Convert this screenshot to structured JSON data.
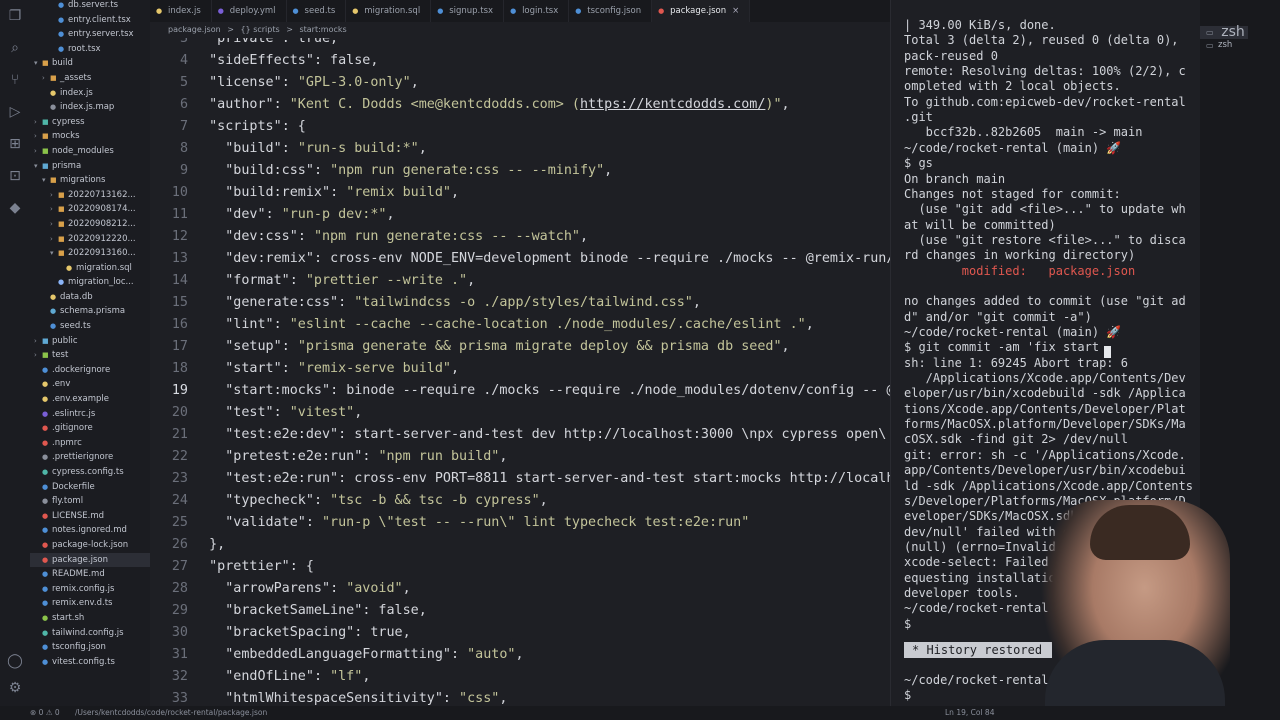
{
  "activity_icons": [
    "files-icon",
    "search-icon",
    "source-control-icon",
    "run-debug-icon",
    "extensions-icon",
    "remote-icon",
    "docker-icon",
    "account-icon",
    "settings-icon"
  ],
  "sidebar": {
    "items": [
      {
        "label": "db.server.ts",
        "indent": 3,
        "kind": "file",
        "color": "#4e8fd6"
      },
      {
        "label": "entry.client.tsx",
        "indent": 3,
        "kind": "file",
        "color": "#4e8fd6"
      },
      {
        "label": "entry.server.tsx",
        "indent": 3,
        "kind": "file",
        "color": "#4e8fd6"
      },
      {
        "label": "root.tsx",
        "indent": 3,
        "kind": "file",
        "color": "#4e8fd6"
      },
      {
        "label": "build",
        "indent": 1,
        "kind": "folder-open",
        "color": "#d8a04a"
      },
      {
        "label": "_assets",
        "indent": 2,
        "kind": "folder",
        "color": "#d8a04a"
      },
      {
        "label": "index.js",
        "indent": 2,
        "kind": "file",
        "color": "#e5c76b"
      },
      {
        "label": "index.js.map",
        "indent": 2,
        "kind": "file",
        "color": "#8a8f9b"
      },
      {
        "label": "cypress",
        "indent": 1,
        "kind": "folder",
        "color": "#4fb6a8"
      },
      {
        "label": "mocks",
        "indent": 1,
        "kind": "folder",
        "color": "#d8a04a"
      },
      {
        "label": "node_modules",
        "indent": 1,
        "kind": "folder",
        "color": "#8bc34a"
      },
      {
        "label": "prisma",
        "indent": 1,
        "kind": "folder-open",
        "color": "#5fa9d3"
      },
      {
        "label": "migrations",
        "indent": 2,
        "kind": "folder-open",
        "color": "#d8a04a"
      },
      {
        "label": "20220713162...",
        "indent": 3,
        "kind": "folder",
        "color": "#d8a04a"
      },
      {
        "label": "20220908174...",
        "indent": 3,
        "kind": "folder",
        "color": "#d8a04a"
      },
      {
        "label": "20220908212...",
        "indent": 3,
        "kind": "folder",
        "color": "#d8a04a"
      },
      {
        "label": "20220912220...",
        "indent": 3,
        "kind": "folder",
        "color": "#d8a04a"
      },
      {
        "label": "20220913160...",
        "indent": 3,
        "kind": "folder-open",
        "color": "#d8a04a"
      },
      {
        "label": "migration.sql",
        "indent": 4,
        "kind": "file",
        "color": "#e5c76b"
      },
      {
        "label": "migration_loc...",
        "indent": 3,
        "kind": "file",
        "color": "#8ab4f8"
      },
      {
        "label": "data.db",
        "indent": 2,
        "kind": "file",
        "color": "#e5c76b"
      },
      {
        "label": "schema.prisma",
        "indent": 2,
        "kind": "file",
        "color": "#5fa9d3"
      },
      {
        "label": "seed.ts",
        "indent": 2,
        "kind": "file",
        "color": "#4e8fd6"
      },
      {
        "label": "public",
        "indent": 1,
        "kind": "folder",
        "color": "#5fa9d3"
      },
      {
        "label": "test",
        "indent": 1,
        "kind": "folder",
        "color": "#8bc34a"
      },
      {
        "label": ".dockerignore",
        "indent": 1,
        "kind": "file",
        "color": "#4e8fd6"
      },
      {
        "label": ".env",
        "indent": 1,
        "kind": "file",
        "color": "#e5c76b"
      },
      {
        "label": ".env.example",
        "indent": 1,
        "kind": "file",
        "color": "#e5c76b"
      },
      {
        "label": ".eslintrc.js",
        "indent": 1,
        "kind": "file",
        "color": "#7a5fd6"
      },
      {
        "label": ".gitignore",
        "indent": 1,
        "kind": "file",
        "color": "#e0574f"
      },
      {
        "label": ".npmrc",
        "indent": 1,
        "kind": "file",
        "color": "#e0574f"
      },
      {
        "label": ".prettierignore",
        "indent": 1,
        "kind": "file",
        "color": "#8a8f9b"
      },
      {
        "label": "cypress.config.ts",
        "indent": 1,
        "kind": "file",
        "color": "#4fb6a8"
      },
      {
        "label": "Dockerfile",
        "indent": 1,
        "kind": "file",
        "color": "#4e8fd6"
      },
      {
        "label": "fly.toml",
        "indent": 1,
        "kind": "file",
        "color": "#8a8f9b"
      },
      {
        "label": "LICENSE.md",
        "indent": 1,
        "kind": "file",
        "color": "#e0574f"
      },
      {
        "label": "notes.ignored.md",
        "indent": 1,
        "kind": "file",
        "color": "#4e8fd6"
      },
      {
        "label": "package-lock.json",
        "indent": 1,
        "kind": "file",
        "color": "#e0574f"
      },
      {
        "label": "package.json",
        "indent": 1,
        "kind": "file",
        "color": "#e0574f",
        "selected": true
      },
      {
        "label": "README.md",
        "indent": 1,
        "kind": "file",
        "color": "#4e8fd6"
      },
      {
        "label": "remix.config.js",
        "indent": 1,
        "kind": "file",
        "color": "#4e8fd6"
      },
      {
        "label": "remix.env.d.ts",
        "indent": 1,
        "kind": "file",
        "color": "#4e8fd6"
      },
      {
        "label": "start.sh",
        "indent": 1,
        "kind": "file",
        "color": "#8bc34a"
      },
      {
        "label": "tailwind.config.js",
        "indent": 1,
        "kind": "file",
        "color": "#4fb6a8"
      },
      {
        "label": "tsconfig.json",
        "indent": 1,
        "kind": "file",
        "color": "#4e8fd6"
      },
      {
        "label": "vitest.config.ts",
        "indent": 1,
        "kind": "file",
        "color": "#4e8fd6"
      }
    ]
  },
  "tabs": [
    {
      "label": "index.js",
      "color": "#e5c76b"
    },
    {
      "label": "deploy.yml",
      "color": "#7a5fd6"
    },
    {
      "label": "seed.ts",
      "color": "#4e8fd6"
    },
    {
      "label": "migration.sql",
      "color": "#e5c76b"
    },
    {
      "label": "signup.tsx",
      "color": "#4e8fd6"
    },
    {
      "label": "login.tsx",
      "color": "#4e8fd6"
    },
    {
      "label": "tsconfig.json",
      "color": "#4e8fd6"
    },
    {
      "label": "package.json",
      "color": "#e0574f",
      "active": true
    }
  ],
  "breadcrumbs": {
    "file": "package.json",
    "sep1": ">",
    "group": "{} scripts",
    "sep2": ">",
    "item": "start:mocks"
  },
  "editor": {
    "lines": [
      {
        "n": "3",
        "text": "  \"private\": true,"
      },
      {
        "n": "4",
        "text": "  \"sideEffects\": false,"
      },
      {
        "n": "5",
        "text": "  \"license\": \"GPL-3.0-only\","
      },
      {
        "n": "6",
        "text": "  \"author\": \"Kent C. Dodds <me@kentcdodds.com> (https://kentcdodds.com/)\","
      },
      {
        "n": "7",
        "text": "  \"scripts\": {"
      },
      {
        "n": "8",
        "text": "    \"build\": \"run-s build:*\","
      },
      {
        "n": "9",
        "text": "    \"build:css\": \"npm run generate:css -- --minify\","
      },
      {
        "n": "10",
        "text": "    \"build:remix\": \"remix build\","
      },
      {
        "n": "11",
        "text": "    \"dev\": \"run-p dev:*\","
      },
      {
        "n": "12",
        "text": "    \"dev:css\": \"npm run generate:css -- --watch\","
      },
      {
        "n": "13",
        "text": "    \"dev:remix\": \"cross-env NODE_ENV=development binode --require ./mocks -- @remix-run/d"
      },
      {
        "n": "14",
        "text": "    \"format\": \"prettier --write .\","
      },
      {
        "n": "15",
        "text": "    \"generate:css\": \"tailwindcss -o ./app/styles/tailwind.css\","
      },
      {
        "n": "16",
        "text": "    \"lint\": \"eslint --cache --cache-location ./node_modules/.cache/eslint .\","
      },
      {
        "n": "17",
        "text": "    \"setup\": \"prisma generate && prisma migrate deploy && prisma db seed\","
      },
      {
        "n": "18",
        "text": "    \"start\": \"remix-serve build\","
      },
      {
        "n": "19",
        "text": "    \"start:mocks\": \"binode --require ./mocks --require ./node_modules/dotenv/config -- @r",
        "current": true
      },
      {
        "n": "20",
        "text": "    \"test\": \"vitest\","
      },
      {
        "n": "21",
        "text": "    \"test:e2e:dev\": \"start-server-and-test dev http://localhost:3000 \\\"npx cypress open\\\""
      },
      {
        "n": "22",
        "text": "    \"pretest:e2e:run\": \"npm run build\","
      },
      {
        "n": "23",
        "text": "    \"test:e2e:run\": \"cross-env PORT=8811 start-server-and-test start:mocks http://localho"
      },
      {
        "n": "24",
        "text": "    \"typecheck\": \"tsc -b && tsc -b cypress\","
      },
      {
        "n": "25",
        "text": "    \"validate\": \"run-p \\\"test -- --run\\\" lint typecheck test:e2e:run\""
      },
      {
        "n": "26",
        "text": "  },"
      },
      {
        "n": "27",
        "text": "  \"prettier\": {"
      },
      {
        "n": "28",
        "text": "    \"arrowParens\": \"avoid\","
      },
      {
        "n": "29",
        "text": "    \"bracketSameLine\": false,"
      },
      {
        "n": "30",
        "text": "    \"bracketSpacing\": true,"
      },
      {
        "n": "31",
        "text": "    \"embeddedLanguageFormatting\": \"auto\","
      },
      {
        "n": "32",
        "text": "    \"endOfLine\": \"lf\","
      },
      {
        "n": "33",
        "text": "    \"htmlWhitespaceSensitivity\": \"css\","
      }
    ]
  },
  "terminal": {
    "lines": [
      {
        "text": "| 349.00 KiB/s, done.",
        "kind": "out"
      },
      {
        "text": "Total 3 (delta 2), reused 0 (delta 0),",
        "kind": "out"
      },
      {
        "text": "pack-reused 0",
        "kind": "out"
      },
      {
        "text": "remote: Resolving deltas: 100% (2/2), c",
        "kind": "out"
      },
      {
        "text": "ompleted with 2 local objects.",
        "kind": "out"
      },
      {
        "text": "To github.com:epicweb-dev/rocket-rental",
        "kind": "out"
      },
      {
        "text": ".git",
        "kind": "out"
      },
      {
        "text": "   bccf32b..82b2605  main -> main",
        "kind": "out"
      },
      {
        "text": "~/code/rocket-rental (main) 🚀",
        "kind": "prompt"
      },
      {
        "text": "$ gs",
        "kind": "prompt"
      },
      {
        "text": "On branch main",
        "kind": "out"
      },
      {
        "text": "Changes not staged for commit:",
        "kind": "out"
      },
      {
        "text": "  (use \"git add <file>...\" to update wh",
        "kind": "out"
      },
      {
        "text": "at will be committed)",
        "kind": "out"
      },
      {
        "text": "  (use \"git restore <file>...\" to disca",
        "kind": "out"
      },
      {
        "text": "rd changes in working directory)",
        "kind": "out"
      },
      {
        "text": "        modified:   package.json",
        "kind": "mod"
      },
      {
        "text": "",
        "kind": "out"
      },
      {
        "text": "no changes added to commit (use \"git ad",
        "kind": "out"
      },
      {
        "text": "d\" and/or \"git commit -a\")",
        "kind": "out"
      },
      {
        "text": "~/code/rocket-rental (main) 🚀",
        "kind": "prompt"
      },
      {
        "text": "$ git commit -am 'fix start",
        "kind": "prompt"
      },
      {
        "text": "sh: line 1: 69245 Abort trap: 6",
        "kind": "out"
      },
      {
        "text": "   /Applications/Xcode.app/Contents/Dev",
        "kind": "out"
      },
      {
        "text": "eloper/usr/bin/xcodebuild -sdk /Applica",
        "kind": "out"
      },
      {
        "text": "tions/Xcode.app/Contents/Developer/Plat",
        "kind": "out"
      },
      {
        "text": "forms/MacOSX.platform/Developer/SDKs/Ma",
        "kind": "out"
      },
      {
        "text": "cOSX.sdk -find git 2> /dev/null",
        "kind": "out"
      },
      {
        "text": "git: error: sh -c '/Applications/Xcode.",
        "kind": "out"
      },
      {
        "text": "app/Contents/Developer/usr/bin/xcodebui",
        "kind": "out"
      },
      {
        "text": "ld -sdk /Applications/Xcode.app/Contents",
        "kind": "out"
      },
      {
        "text": "s/Developer/Platforms/MacOSX.platform/D",
        "kind": "out"
      },
      {
        "text": "eveloper/SDKs/MacOSX.sdk -find git 2> /",
        "kind": "out"
      },
      {
        "text": "dev/null' failed with exit code 34304:",
        "kind": "out"
      },
      {
        "text": "(null) (errno=Invalid argument)",
        "kind": "out"
      },
      {
        "text": "xcode-select: Failed to locate 'git', r",
        "kind": "out"
      },
      {
        "text": "equesting installation of command line",
        "kind": "out"
      },
      {
        "text": "developer tools.",
        "kind": "out"
      },
      {
        "text": "~/code/rocket-rental (main) 🚀",
        "kind": "prompt"
      },
      {
        "text": "$",
        "kind": "prompt"
      }
    ],
    "history_label": "* History restored",
    "after": [
      {
        "text": "~/code/rocket-rental (main) 🚀",
        "kind": "prompt"
      },
      {
        "text": "$",
        "kind": "prompt"
      }
    ]
  },
  "terminal_tabs": [
    {
      "label": "zsh",
      "active": true
    },
    {
      "label": "zsh",
      "active": false
    }
  ],
  "status": {
    "left": "⊗ 0 ⚠ 0",
    "path": "/Users/kentcdodds/code/rocket-rental/package.json",
    "cursor": "Ln 19, Col 84"
  },
  "colors": {
    "accent": "#e0574f",
    "bg": "#1e1f24"
  }
}
